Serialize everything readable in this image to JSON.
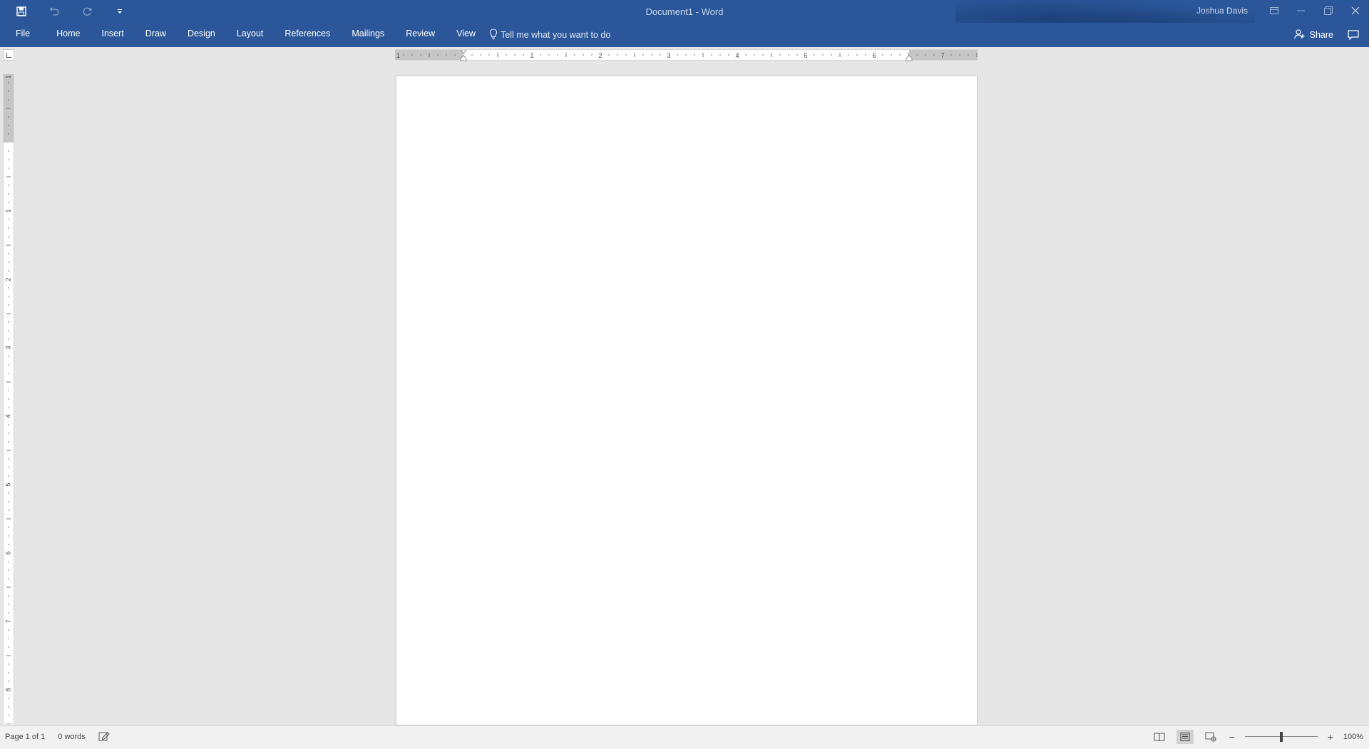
{
  "title_bar": {
    "document_title": "Document1 - Word",
    "user_name": "Joshua Davis",
    "quick_access": [
      {
        "name": "save-icon"
      },
      {
        "name": "undo-icon"
      },
      {
        "name": "redo-icon"
      },
      {
        "name": "customize-qat-icon"
      }
    ]
  },
  "ribbon": {
    "tabs": [
      "File",
      "Home",
      "Insert",
      "Draw",
      "Design",
      "Layout",
      "References",
      "Mailings",
      "Review",
      "View"
    ],
    "tell_me": "Tell me what you want to do",
    "share": "Share"
  },
  "ruler": {
    "horizontal_labels": [
      "1",
      "1",
      "2",
      "3",
      "4",
      "5",
      "6",
      "7"
    ],
    "vertical_labels": [
      "1",
      "1",
      "2",
      "3",
      "4",
      "5",
      "6",
      "7",
      "8"
    ]
  },
  "status_bar": {
    "page_info": "Page 1 of 1",
    "word_count": "0 words",
    "zoom_level": "100%",
    "zoom_fraction": 0.5
  },
  "colors": {
    "ribbon": "#2b579a",
    "canvas": "#e6e6e6",
    "statusbar": "#f1f1f1"
  }
}
